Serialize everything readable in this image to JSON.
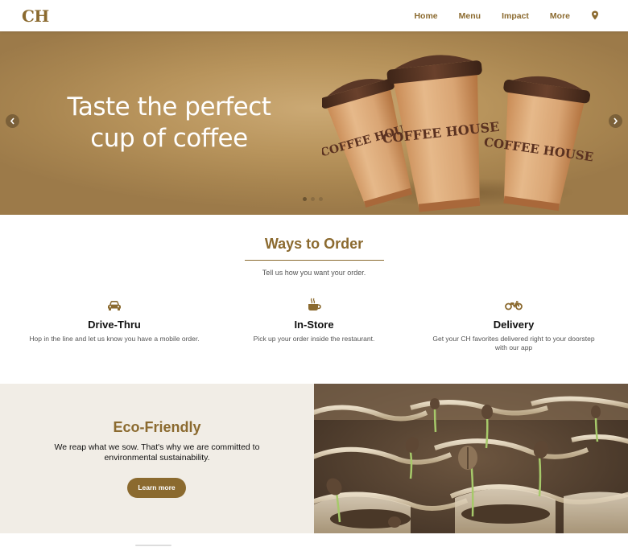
{
  "nav": {
    "logo": "CH",
    "links": [
      "Home",
      "Menu",
      "Impact",
      "More"
    ],
    "location_icon": "map-pin-icon"
  },
  "hero": {
    "title": "Taste the perfect cup of coffee",
    "cup_label": "COFFEE HOUSE",
    "slides": 3,
    "active_slide": 1,
    "prev_icon": "chevron-left-icon",
    "next_icon": "chevron-right-icon"
  },
  "ways": {
    "title": "Ways to Order",
    "subtitle": "Tell us how you want your order.",
    "options": [
      {
        "icon": "car-icon",
        "name": "Drive-Thru",
        "description": "Hop in the line and let us know you have a mobile order."
      },
      {
        "icon": "coffee-cup-icon",
        "name": "In-Store",
        "description": "Pick up your order inside the restaurant."
      },
      {
        "icon": "motorcycle-icon",
        "name": "Delivery",
        "description": "Get your CH favorites delivered right to your doorstep with our app"
      }
    ]
  },
  "eco": {
    "title": "Eco-Friendly",
    "text": "We reap what we sow. That's why we are committed to environmental sustainability.",
    "button": "Learn more",
    "image": "coffee-seedlings-photo"
  },
  "colors": {
    "brand": "#8b6a2f",
    "hero_bg": "#b8945c",
    "eco_bg": "#f1ede6"
  }
}
